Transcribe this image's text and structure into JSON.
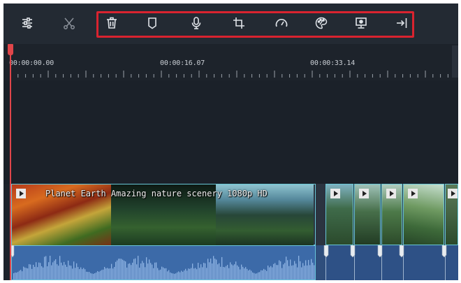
{
  "toolbar": {
    "tools": [
      {
        "name": "adjust-icon",
        "in_highlight": false
      },
      {
        "name": "scissors-icon",
        "in_highlight": false
      },
      {
        "name": "delete-icon",
        "in_highlight": true
      },
      {
        "name": "marker-icon",
        "in_highlight": true
      },
      {
        "name": "microphone-icon",
        "in_highlight": true
      },
      {
        "name": "crop-icon",
        "in_highlight": true
      },
      {
        "name": "speed-icon",
        "in_highlight": true
      },
      {
        "name": "color-palette-icon",
        "in_highlight": true
      },
      {
        "name": "screen-record-icon",
        "in_highlight": true
      },
      {
        "name": "export-icon",
        "in_highlight": true
      }
    ],
    "highlight_color": "#d9232f"
  },
  "ruler": {
    "timecodes": [
      "00:00:00.00",
      "00:00:16.07",
      "00:00:33.14"
    ]
  },
  "timeline": {
    "main_clip": {
      "title": "Planet Earth  Amazing nature scenery 1080p HD"
    },
    "clip_border_color": "#68c7d6",
    "playhead_color": "#e0464a",
    "audio_color": "#3c6aa8"
  }
}
